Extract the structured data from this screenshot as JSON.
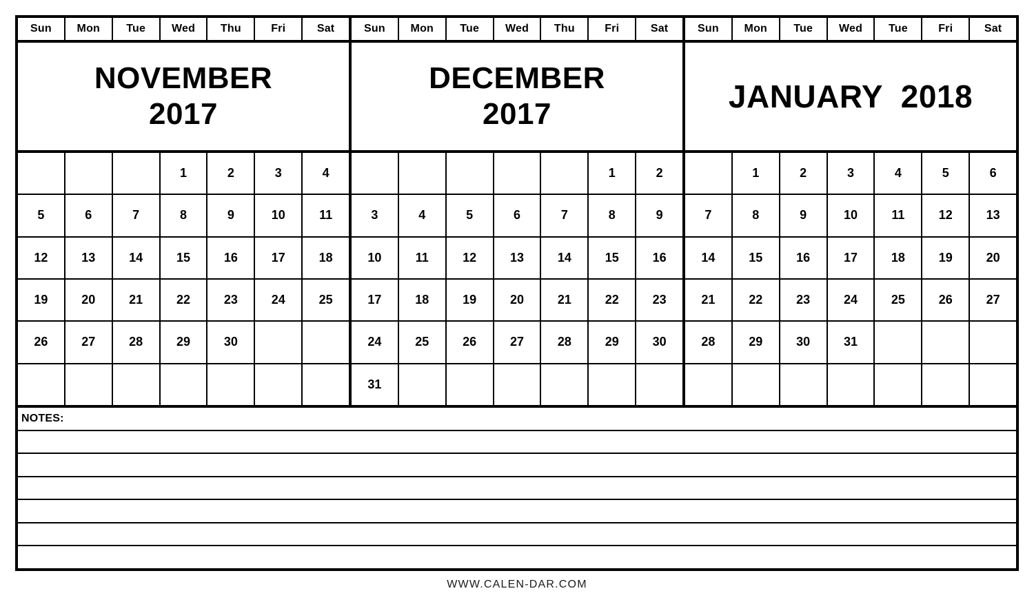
{
  "document": {
    "type": "three-month-calendar",
    "footer_text": "WWW.CALEN-DAR.COM",
    "notes_label": "NOTES:",
    "notes_blank_lines": 6
  },
  "months": [
    {
      "id": "november-2017",
      "title_line1": "NOVEMBER",
      "title_line2": "2017",
      "single_line": false,
      "weekdays": [
        "Sun",
        "Mon",
        "Tue",
        "Wed",
        "Thu",
        "Fri",
        "Sat"
      ],
      "weeks": [
        [
          "",
          "",
          "",
          "1",
          "2",
          "3",
          "4"
        ],
        [
          "5",
          "6",
          "7",
          "8",
          "9",
          "10",
          "11"
        ],
        [
          "12",
          "13",
          "14",
          "15",
          "16",
          "17",
          "18"
        ],
        [
          "19",
          "20",
          "21",
          "22",
          "23",
          "24",
          "25"
        ],
        [
          "26",
          "27",
          "28",
          "29",
          "30",
          "",
          ""
        ],
        [
          "",
          "",
          "",
          "",
          "",
          "",
          ""
        ]
      ]
    },
    {
      "id": "december-2017",
      "title_line1": "DECEMBER",
      "title_line2": "2017",
      "single_line": false,
      "weekdays": [
        "Sun",
        "Mon",
        "Tue",
        "Wed",
        "Thu",
        "Fri",
        "Sat"
      ],
      "weeks": [
        [
          "",
          "",
          "",
          "",
          "",
          "1",
          "2"
        ],
        [
          "3",
          "4",
          "5",
          "6",
          "7",
          "8",
          "9"
        ],
        [
          "10",
          "11",
          "12",
          "13",
          "14",
          "15",
          "16"
        ],
        [
          "17",
          "18",
          "19",
          "20",
          "21",
          "22",
          "23"
        ],
        [
          "24",
          "25",
          "26",
          "27",
          "28",
          "29",
          "30"
        ],
        [
          "31",
          "",
          "",
          "",
          "",
          "",
          ""
        ]
      ]
    },
    {
      "id": "january-2018",
      "title_line1": "JANUARY  2018",
      "title_line2": "",
      "single_line": true,
      "weekdays": [
        "Sun",
        "Mon",
        "Tue",
        "Wed",
        "Tue",
        "Fri",
        "Sat"
      ],
      "weeks": [
        [
          "",
          "1",
          "2",
          "3",
          "4",
          "5",
          "6"
        ],
        [
          "7",
          "8",
          "9",
          "10",
          "11",
          "12",
          "13"
        ],
        [
          "14",
          "15",
          "16",
          "17",
          "18",
          "19",
          "20"
        ],
        [
          "21",
          "22",
          "23",
          "24",
          "25",
          "26",
          "27"
        ],
        [
          "28",
          "29",
          "30",
          "31",
          "",
          "",
          ""
        ],
        [
          "",
          "",
          "",
          "",
          "",
          "",
          ""
        ]
      ]
    }
  ],
  "colors": {
    "ink": "#000000",
    "paper": "#ffffff"
  }
}
